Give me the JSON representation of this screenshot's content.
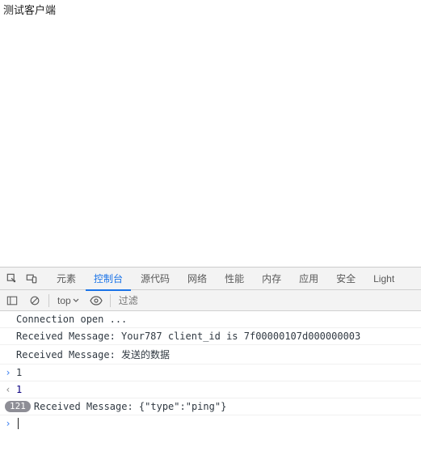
{
  "page": {
    "title": "测试客户端"
  },
  "devtools": {
    "tabs": {
      "elements": "元素",
      "console": "控制台",
      "sources": "源代码",
      "network": "网络",
      "performance": "性能",
      "memory": "内存",
      "application": "应用",
      "security": "安全",
      "lighthouse": "Light"
    },
    "toolbar": {
      "context": "top",
      "filter_placeholder": "过滤"
    },
    "logs": {
      "l0": "Connection open ...",
      "l1": "Received Message: Your787 client_id is 7f00000107d000000003",
      "l2": "Received Message: 发送的数据",
      "l3_in": "1",
      "l3_out": "1",
      "l4_count": "121",
      "l4_msg": "Received Message: {\"type\":\"ping\"}"
    }
  }
}
